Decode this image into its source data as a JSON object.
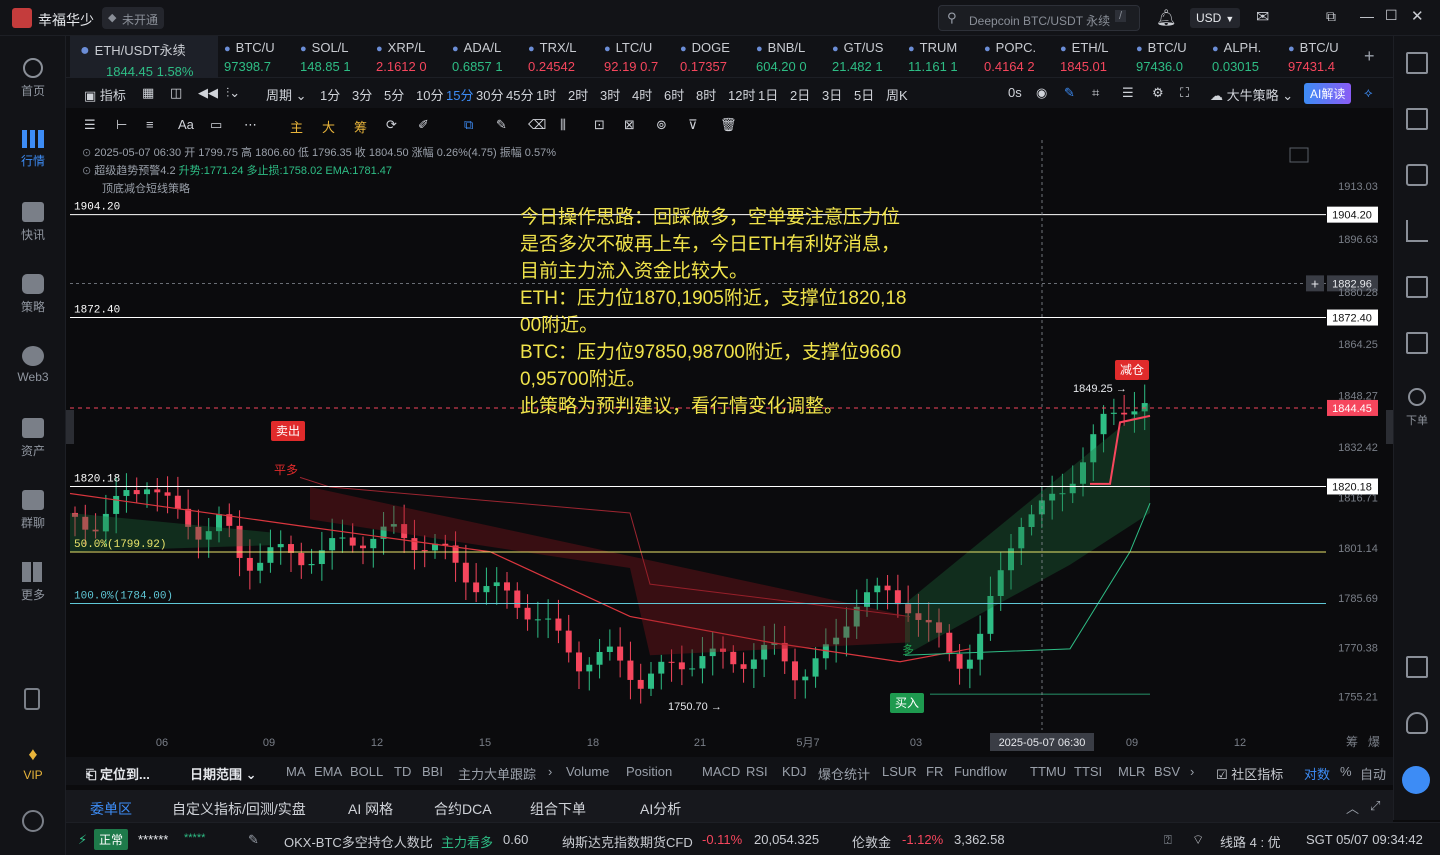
{
  "app": {
    "name": "幸福华少",
    "status": "未开通"
  },
  "search": {
    "placeholder": "Deepcoin BTC/USDT 永续",
    "shortcut": "/"
  },
  "currency": "USD",
  "tabs": [
    {
      "name": "ETH/USDT永续",
      "price": "1844.45",
      "change": "1.58%",
      "dir": "up",
      "active": true
    },
    {
      "name": "BTC/U",
      "price": "97398.7",
      "change": "",
      "dir": "up"
    },
    {
      "name": "SOL/L",
      "price": "148.85",
      "change": "1",
      "dir": "up"
    },
    {
      "name": "XRP/L",
      "price": "2.1612",
      "change": "0",
      "dir": "dn"
    },
    {
      "name": "ADA/L",
      "price": "0.6857",
      "change": "1",
      "dir": "up"
    },
    {
      "name": "TRX/L",
      "price": "0.24542",
      "change": "",
      "dir": "dn"
    },
    {
      "name": "LTC/U",
      "price": "92.19",
      "change": "0.7",
      "dir": "dn"
    },
    {
      "name": "DOGE",
      "price": "0.17357",
      "change": "",
      "dir": "dn"
    },
    {
      "name": "BNB/L",
      "price": "604.20",
      "change": "0",
      "dir": "up"
    },
    {
      "name": "GT/US",
      "price": "21.482",
      "change": "1",
      "dir": "up"
    },
    {
      "name": "TRUM",
      "price": "11.161",
      "change": "1",
      "dir": "up"
    },
    {
      "name": "POPC.",
      "price": "0.4164",
      "change": "2",
      "dir": "dn"
    },
    {
      "name": "ETH/L",
      "price": "1845.01",
      "change": "",
      "dir": "dn"
    },
    {
      "name": "BTC/U",
      "price": "97436.0",
      "change": "",
      "dir": "up"
    },
    {
      "name": "ALPH.",
      "price": "0.03015",
      "change": "",
      "dir": "up"
    },
    {
      "name": "BTC/U",
      "price": "97431.4",
      "change": "",
      "dir": "dn"
    }
  ],
  "toolbar1": {
    "indicator": "指标",
    "period": "周期",
    "intervals": [
      "1分",
      "3分",
      "5分",
      "10分",
      "15分",
      "30分",
      "45分",
      "1时",
      "2时",
      "3时",
      "4时",
      "6时",
      "8时",
      "12时",
      "1日",
      "2日",
      "3日",
      "5日",
      "周K"
    ],
    "active_interval": "15分",
    "zero_s": "0s",
    "strategy": "大牛策略",
    "ai": "AI解读"
  },
  "toolbar2": {
    "text_tool": "Aa",
    "labels": [
      "主",
      "大",
      "筹"
    ]
  },
  "legend": {
    "ohlc": "2025-05-07 06:30  开 1799.75  高 1806.60  低 1796.35  收 1804.50  涨幅 0.26%(4.75)  振幅 0.57%",
    "line2_name": "超级趋势预警4.2",
    "line2_values": "升势:1771.24  多止损:1758.02  EMA:1781.47",
    "line3": "顶底减仓短线策略"
  },
  "annotation": "今日操作思路：回踩做多，空单要注意压力位是否多次不破再上车，今日ETH有利好消息，目前主力流入资金比较大。\nETH：压力位1870,1905附近，支撑位1820,1800附近。\nBTC：压力位97850,98700附近，支撑位96600,95700附近。\n此策略为预判建议，看行情变化调整。",
  "chart_data": {
    "type": "candlestick",
    "symbol": "ETH/USDT永续",
    "interval": "15分",
    "y_ticks": [
      1913.03,
      1896.63,
      1880.28,
      1864.25,
      1848.27,
      1832.42,
      1816.71,
      1801.14,
      1785.69,
      1770.38,
      1755.21
    ],
    "x_ticks": [
      "06",
      "09",
      "12",
      "15",
      "18",
      "21",
      "5月7",
      "03",
      "06",
      "09",
      "12"
    ],
    "crosshair_time": "2025-05-07 06:30",
    "crosshair_price": "1882.96",
    "last_price": "1844.45",
    "horizontal_lines": [
      {
        "label": "1904.20",
        "value": 1904.2,
        "color": "#ffffff"
      },
      {
        "label": "1872.40",
        "value": 1872.4,
        "color": "#ffffff"
      },
      {
        "label": "1820.18",
        "value": 1820.18,
        "color": "#ffffff"
      },
      {
        "label": "50.0%(1799.92)",
        "value": 1799.92,
        "color": "#e8e36a"
      },
      {
        "label": "100.0%(1784.00)",
        "value": 1784.0,
        "color": "#5fc7d6"
      }
    ],
    "labels": {
      "high": "1849.25",
      "low": "1750.70",
      "sell": "卖出",
      "buy": "买入",
      "reduce": "减仓",
      "flat_long": "平多",
      "long": "多"
    },
    "watermark_right": [
      "筹",
      "爆"
    ]
  },
  "bottom_tools": {
    "locate": "定位到...",
    "date_range": "日期范围",
    "indicators": [
      "MA",
      "EMA",
      "BOLL",
      "TD",
      "BBI",
      "主力大单跟踪",
      "Volume",
      "Position",
      "MACD",
      "RSI",
      "KDJ",
      "爆仓统计",
      "LSUR",
      "FR",
      "Fundflow",
      "TTMU",
      "TTSI",
      "MLR",
      "BSV"
    ],
    "community": "社区指标",
    "log": "对数",
    "pct": "%",
    "auto": "自动"
  },
  "bottom_panel": {
    "tabs": [
      "委单区",
      "自定义指标/回测/实盘",
      "AI 网格",
      "合约DCA",
      "组合下单",
      "AI分析"
    ],
    "active": "委单区"
  },
  "statusbar": {
    "state": "正常",
    "account": "******",
    "ticker1_name": "OKX-BTC多空持仓人数比",
    "ticker1_tag": "主力看多",
    "ticker1_val": "0.60",
    "ticker2_name": "纳斯达克指数期货CFD",
    "ticker2_chg": "-0.11%",
    "ticker2_val": "20,054.325",
    "ticker3_name": "伦敦金",
    "ticker3_chg": "-1.12%",
    "ticker3_val": "3,362.58",
    "line": "线路 4 : 优",
    "time": "SGT 05/07 09:34:42"
  },
  "leftnav": [
    "首页",
    "行情",
    "快讯",
    "策略",
    "Web3",
    "资产",
    "群聊",
    "更多",
    "VIP"
  ],
  "rightnav": {
    "order": "下单"
  }
}
